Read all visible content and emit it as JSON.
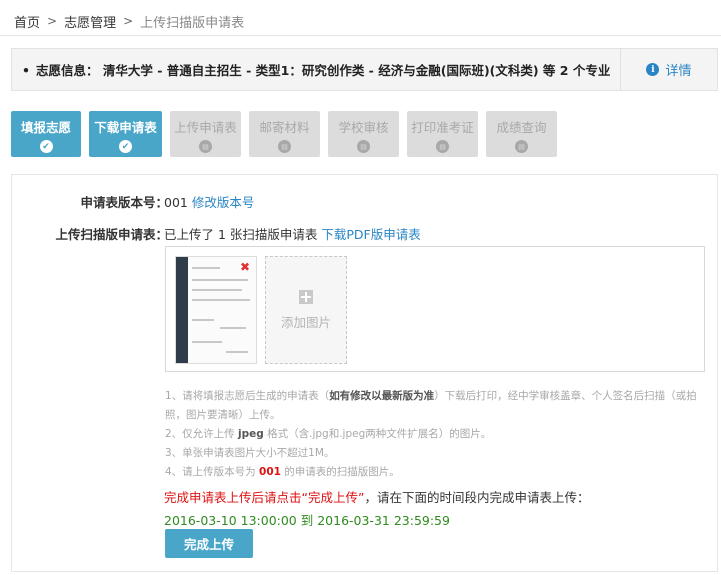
{
  "breadcrumb": {
    "items": [
      "首页",
      "志愿管理"
    ],
    "current": "上传扫描版申请表"
  },
  "info_bar": {
    "text": "志愿信息： 清华大学 - 普通自主招生 - 类型1：研究创作类 - 经济与金融(国际班)(文科类) 等 2 个专业",
    "bullet": "•",
    "detail_label": "详情",
    "detail_icon": "i"
  },
  "steps": [
    {
      "label": "填报志愿",
      "state": "active",
      "icon": "✔"
    },
    {
      "label": "下载申请表",
      "state": "active",
      "icon": "✔"
    },
    {
      "label": "上传申请表",
      "state": "inactive",
      "icon": "▤"
    },
    {
      "label": "邮寄材料",
      "state": "inactive",
      "icon": "▤"
    },
    {
      "label": "学校审核",
      "state": "inactive",
      "icon": "▤"
    },
    {
      "label": "打印准考证",
      "state": "inactive",
      "icon": "▤"
    },
    {
      "label": "成绩查询",
      "state": "inactive",
      "icon": "▤"
    }
  ],
  "form": {
    "version_label": "申请表版本号：",
    "version_value": "001",
    "modify_version_link": "修改版本号",
    "upload_label": "上传扫描版申请表：",
    "upload_status": "已上传了 1 张扫描版申请表",
    "download_pdf_link": "下载PDF版申请表",
    "add_image_label": "添加图片"
  },
  "notes": {
    "n1_a": "1、请将填报志愿后生成的申请表（",
    "n1_b": "如有修改以最新版为准",
    "n1_c": "）下载后打印，经中学审核盖章、个人签名后扫描（或拍照，图片要清晰）上传。",
    "n2_a": "2、仅允许上传 ",
    "n2_b": "jpeg",
    "n2_c": " 格式（含.jpg和.jpeg两种文件扩展名）的图片。",
    "n3": "3、单张申请表图片大小不超过1M。",
    "n4_a": "4、请上传版本号为 ",
    "n4_b": "001",
    "n4_c": " 的申请表的扫描版图片。"
  },
  "warning": {
    "red": "完成申请表上传后请点击“完成上传”",
    "dark": "，请在下面的时间段内完成申请表上传："
  },
  "period": "2016-03-10 13:00:00 到 2016-03-31 23:59:59",
  "finish_button": "完成上传",
  "colors": {
    "accent": "#4aa6c9",
    "link": "#2a85c5",
    "warning": "#d11111",
    "period": "#2e8b1e"
  }
}
